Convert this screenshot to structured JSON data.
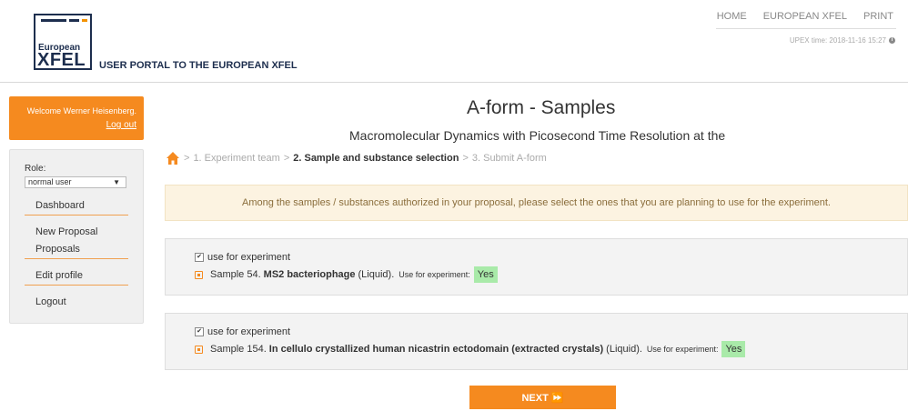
{
  "header": {
    "logo_word1": "European",
    "logo_word2": "XFEL",
    "portal_title": "USER PORTAL TO THE EUROPEAN XFEL",
    "nav": [
      "HOME",
      "EUROPEAN XFEL",
      "PRINT"
    ],
    "upex_time": "UPEX time: 2018-11-16 15:27"
  },
  "welcome": {
    "text": "Welcome Werner Heisenberg.",
    "logout": "Log out"
  },
  "sidebar": {
    "role_label": "Role:",
    "role_value": "normal user",
    "items": [
      "Dashboard",
      "New Proposal",
      "Proposals",
      "Edit profile",
      "Logout"
    ]
  },
  "main": {
    "title": "A-form - Samples",
    "subtitle": "Macromolecular Dynamics with Picosecond Time Resolution at the",
    "breadcrumb": {
      "step1": "1. Experiment team",
      "step2": "2. Sample and substance selection",
      "step3": "3. Submit A-form",
      "separator": ">"
    },
    "alert": "Among the samples / substances authorized in your proposal, please select the ones that you are planning to use for the experiment.",
    "samples": [
      {
        "checkbox_label": "use for experiment",
        "prefix": "Sample 54.",
        "name": "MS2 bacteriophage",
        "state": "(Liquid).",
        "use_label": "Use for experiment:",
        "use_value": "Yes"
      },
      {
        "checkbox_label": "use for experiment",
        "prefix": "Sample 154.",
        "name": "In cellulo crystallized human nicastrin ectodomain (extracted crystals)",
        "state": "(Liquid).",
        "use_label": "Use for experiment:",
        "use_value": "Yes"
      }
    ],
    "next_button": "NEXT ⏩"
  },
  "colors": {
    "accent": "#f58a1f",
    "brand_navy": "#1d2e4e",
    "alert_bg": "#fcf3e1",
    "yes_bg": "#a9eaa9"
  }
}
